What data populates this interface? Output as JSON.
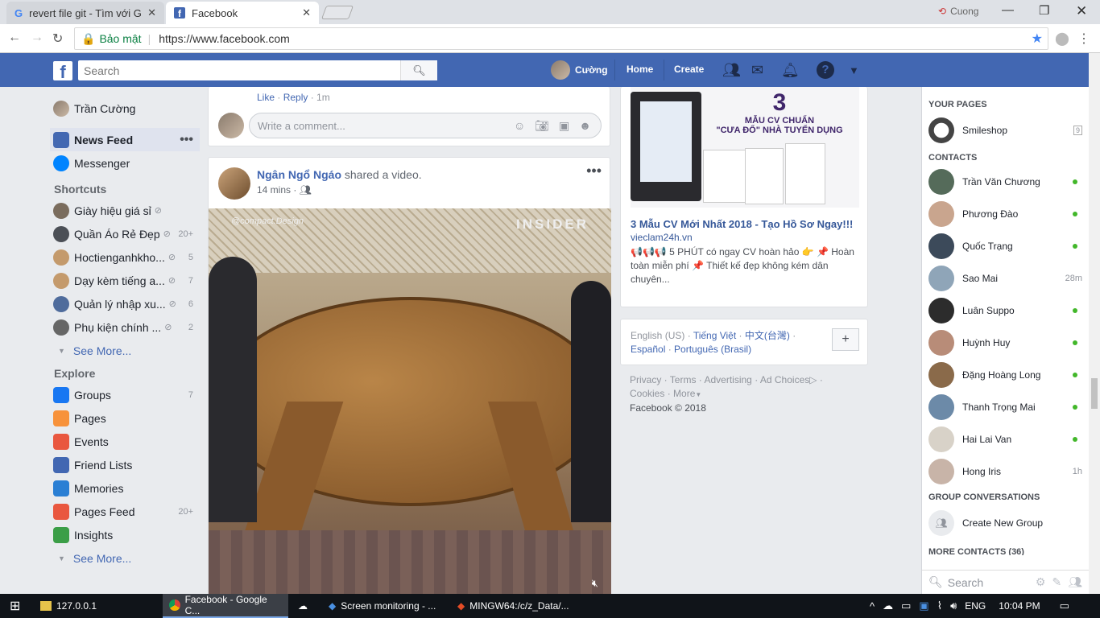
{
  "browser": {
    "tabs": [
      {
        "label": "revert file git - Tìm với Gc",
        "active": false
      },
      {
        "label": "Facebook",
        "active": true
      }
    ],
    "profile_name": "Cuong",
    "secure_label": "Bảo mật",
    "url": "https://www.facebook.com"
  },
  "header": {
    "search_placeholder": "Search",
    "user_name": "Cường",
    "home": "Home",
    "create": "Create"
  },
  "left": {
    "user": "Trần Cường",
    "news_feed": "News Feed",
    "messenger": "Messenger",
    "shortcuts_title": "Shortcuts",
    "shortcuts": [
      {
        "label": "Giày hiệu giá sỉ",
        "count": ""
      },
      {
        "label": "Quần Áo Rẻ Đẹp",
        "count": "20+"
      },
      {
        "label": "Hoctienganhkho...",
        "count": "5"
      },
      {
        "label": "Dạy kèm tiếng a...",
        "count": "7"
      },
      {
        "label": "Quản lý nhập xu...",
        "count": "6"
      },
      {
        "label": "Phụ kiện chính ...",
        "count": "2"
      }
    ],
    "see_more": "See More...",
    "explore_title": "Explore",
    "explore": [
      {
        "label": "Groups",
        "count": "7",
        "color": "#1877f2"
      },
      {
        "label": "Pages",
        "count": "",
        "color": "#f7923b"
      },
      {
        "label": "Events",
        "count": "",
        "color": "#e9573f"
      },
      {
        "label": "Friend Lists",
        "count": "",
        "color": "#4267b2"
      },
      {
        "label": "Memories",
        "count": "",
        "color": "#2a7fd4"
      },
      {
        "label": "Pages Feed",
        "count": "20+",
        "color": "#e9573f"
      },
      {
        "label": "Insights",
        "count": "",
        "color": "#3b9e47"
      }
    ]
  },
  "feed": {
    "comment_actions": {
      "like": "Like",
      "reply": "Reply",
      "time": "1m"
    },
    "comment_placeholder": "Write a comment...",
    "post": {
      "author": "Ngân Ngổ Ngáo",
      "action": "shared a video.",
      "time": "14 mins",
      "video_watermark": "INSIDER",
      "video_caption": "@compact.Design"
    }
  },
  "ad": {
    "image_big": "3",
    "image_line1": "MẪU CV CHUẨN",
    "image_line2": "\"CƯA ĐỔ\" NHÀ TUYỂN DỤNG",
    "title": "3 Mẫu CV Mới Nhất 2018 - Tạo Hồ Sơ Ngay!!!",
    "domain": "vieclam24h.vn",
    "text": "📢📢📢 5 PHÚT có ngay CV hoàn hảo 👉 📌 Hoàn toàn miễn phí 📌 Thiết kế đẹp không kém dân chuyên..."
  },
  "languages": {
    "current": "English (US)",
    "others": [
      "Tiếng Việt",
      "中文(台灣)",
      "Español",
      "Português (Brasil)"
    ],
    "add": "+"
  },
  "footer": {
    "links": [
      "Privacy",
      "Terms",
      "Advertising",
      "Ad Choices",
      "Cookies",
      "More"
    ],
    "copyright": "Facebook © 2018"
  },
  "chat": {
    "your_pages": "YOUR PAGES",
    "page_name": "Smileshop",
    "page_count": "9",
    "contacts_title": "CONTACTS",
    "contacts": [
      {
        "name": "Trần Văn Chương",
        "status": "online"
      },
      {
        "name": "Phương Đào",
        "status": "online"
      },
      {
        "name": "Quốc Trạng",
        "status": "online"
      },
      {
        "name": "Sao Mai",
        "status": "28m"
      },
      {
        "name": "Luân Suppo",
        "status": "online"
      },
      {
        "name": "Huỳnh Huy",
        "status": "online"
      },
      {
        "name": "Đặng Hoàng Long",
        "status": "online"
      },
      {
        "name": "Thanh Trọng Mai",
        "status": "online"
      },
      {
        "name": "Hai Lai Van",
        "status": "online"
      },
      {
        "name": "Hong Iris",
        "status": "1h"
      }
    ],
    "group_title": "GROUP CONVERSATIONS",
    "create_group": "Create New Group",
    "more_contacts": "MORE CONTACTS (36)",
    "search_placeholder": "Search"
  },
  "taskbar": {
    "items": [
      "127.0.0.1",
      "Facebook - Google C...",
      "",
      "Screen monitoring - ...",
      "MINGW64:/c/z_Data/..."
    ],
    "lang": "ENG",
    "time": "10:04 PM"
  },
  "colors": {
    "fb_blue": "#4267b2",
    "online": "#42b72a",
    "link": "#4267b2"
  }
}
